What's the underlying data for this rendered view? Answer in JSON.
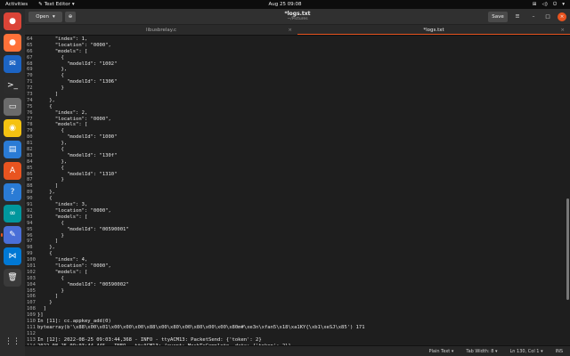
{
  "topbar": {
    "activities": "Activities",
    "app_name": "Text Editor",
    "clock": "Aug 25  09:08"
  },
  "dock": [
    {
      "name": "chrome-icon",
      "color": "#db4437",
      "glyph": "●"
    },
    {
      "name": "firefox-icon",
      "color": "#ff7139",
      "glyph": "●"
    },
    {
      "name": "thunderbird-icon",
      "color": "#1c64c4",
      "glyph": "✉"
    },
    {
      "name": "terminal-icon",
      "color": "#2c2c2c",
      "glyph": ">_"
    },
    {
      "name": "files-icon",
      "color": "#6b6b6b",
      "glyph": "▭"
    },
    {
      "name": "rhythmbox-icon",
      "color": "#f5c211",
      "glyph": "◉"
    },
    {
      "name": "writer-icon",
      "color": "#2a7bd5",
      "glyph": "▤"
    },
    {
      "name": "software-icon",
      "color": "#e95420",
      "glyph": "A"
    },
    {
      "name": "help-icon",
      "color": "#2a7bd5",
      "glyph": "?"
    },
    {
      "name": "arduino-icon",
      "color": "#00979d",
      "glyph": "∞"
    },
    {
      "name": "texteditor-icon",
      "color": "#4a6fd8",
      "glyph": "✎",
      "active": true
    },
    {
      "name": "vscode-icon",
      "color": "#0078d4",
      "glyph": "⋈"
    },
    {
      "name": "trash-icon",
      "color": "#3a3a3a",
      "glyph": "🗑"
    }
  ],
  "header": {
    "open_label": "Open",
    "title": "*logs.txt",
    "path": "~/Pictures",
    "save_label": "Save"
  },
  "tabs": [
    {
      "label": "libusbrelay.c",
      "active": false
    },
    {
      "label": "*logs.txt",
      "active": true
    }
  ],
  "lines": [
    {
      "n": "64",
      "t": "      \"index\": 1,"
    },
    {
      "n": "65",
      "t": "      \"location\": \"0000\","
    },
    {
      "n": "66",
      "t": "      \"models\": ["
    },
    {
      "n": "67",
      "t": "        {"
    },
    {
      "n": "68",
      "t": "          \"modelId\": \"1002\""
    },
    {
      "n": "69",
      "t": "        },"
    },
    {
      "n": "70",
      "t": "        {"
    },
    {
      "n": "71",
      "t": "          \"modelId\": \"1306\""
    },
    {
      "n": "72",
      "t": "        }"
    },
    {
      "n": "73",
      "t": "      ]"
    },
    {
      "n": "74",
      "t": "    },"
    },
    {
      "n": "75",
      "t": "    {"
    },
    {
      "n": "76",
      "t": "      \"index\": 2,"
    },
    {
      "n": "77",
      "t": "      \"location\": \"0000\","
    },
    {
      "n": "78",
      "t": "      \"models\": ["
    },
    {
      "n": "79",
      "t": "        {"
    },
    {
      "n": "80",
      "t": "          \"modelId\": \"1000\""
    },
    {
      "n": "81",
      "t": "        },"
    },
    {
      "n": "82",
      "t": "        {"
    },
    {
      "n": "83",
      "t": "          \"modelId\": \"130f\""
    },
    {
      "n": "84",
      "t": "        },"
    },
    {
      "n": "85",
      "t": "        {"
    },
    {
      "n": "86",
      "t": "          \"modelId\": \"1310\""
    },
    {
      "n": "87",
      "t": "        }"
    },
    {
      "n": "88",
      "t": "      ]"
    },
    {
      "n": "89",
      "t": "    },"
    },
    {
      "n": "90",
      "t": "    {"
    },
    {
      "n": "91",
      "t": "      \"index\": 3,"
    },
    {
      "n": "92",
      "t": "      \"location\": \"0000\","
    },
    {
      "n": "93",
      "t": "      \"models\": ["
    },
    {
      "n": "94",
      "t": "        {"
    },
    {
      "n": "95",
      "t": "          \"modelId\": \"00590001\""
    },
    {
      "n": "96",
      "t": "        }"
    },
    {
      "n": "97",
      "t": "      ]"
    },
    {
      "n": "98",
      "t": "    },"
    },
    {
      "n": "99",
      "t": "    {"
    },
    {
      "n": "100",
      "t": "      \"index\": 4,"
    },
    {
      "n": "101",
      "t": "      \"location\": \"0000\","
    },
    {
      "n": "102",
      "t": "      \"models\": ["
    },
    {
      "n": "103",
      "t": "        {"
    },
    {
      "n": "104",
      "t": "          \"modelId\": \"00590002\""
    },
    {
      "n": "105",
      "t": "        }"
    },
    {
      "n": "106",
      "t": "      ]"
    },
    {
      "n": "107",
      "t": "    }"
    },
    {
      "n": "108",
      "t": "  ]"
    },
    {
      "n": "109",
      "t": "}]"
    },
    {
      "n": "110",
      "t": "In [11]: cc.appkey_add(0)"
    },
    {
      "n": "111",
      "t": "bytearray(b'\\x88\\x00\\x01\\x00\\x00\\x00\\x88\\x00\\x80\\x00\\x80\\x00\\x00\\x80m#\\xe3n\\xfan5\\x18\\xa1KY{\\xb1\\xeSJ\\x85') 171"
    },
    {
      "n": "112",
      "t": ""
    },
    {
      "n": "113",
      "t": "In [12]: 2022-08-25 09:03:44,368 - INFO - ttyACM13: PacketSend: {'token': 2}"
    },
    {
      "n": "114",
      "t": "2022-08-25 09:03:44,445 - INFO - ttyACM13: {event: MeshTxComplete, data: {'token': 2}}"
    }
  ],
  "status": {
    "syntax": "Plain Text",
    "tab_width": "Tab Width: 8",
    "position": "Ln 130, Col 1",
    "mode": "INS"
  },
  "colors": {
    "accent": "#e95420"
  }
}
